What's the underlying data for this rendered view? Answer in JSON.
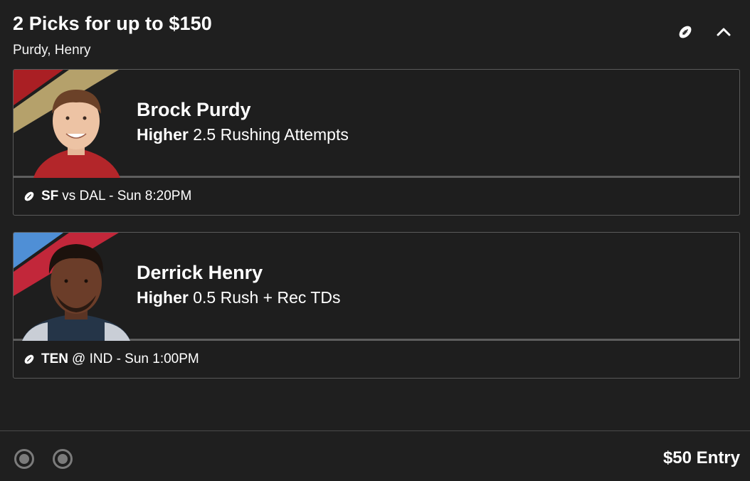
{
  "header": {
    "title": "2 Picks for up to $150",
    "subtitle": "Purdy, Henry",
    "icons": [
      "football-icon",
      "chevron-up-icon"
    ]
  },
  "picks": [
    {
      "player": "Brock Purdy",
      "direction": "Higher",
      "line": "2.5 Rushing Attempts",
      "team": "SF",
      "matchup": "vs DAL - Sun 8:20PM",
      "stripe_colors": [
        "#aa1f24",
        "#b5a16b"
      ],
      "jersey_color": "#b3262a"
    },
    {
      "player": "Derrick Henry",
      "direction": "Higher",
      "line": "0.5 Rush + Rec TDs",
      "team": "TEN",
      "matchup": "@ IND - Sun 1:00PM",
      "stripe_colors": [
        "#4f8fd6",
        "#c2273a"
      ],
      "jersey_color": "#253548"
    }
  ],
  "footer": {
    "entry": "$50 Entry",
    "progress_dots": 2
  }
}
